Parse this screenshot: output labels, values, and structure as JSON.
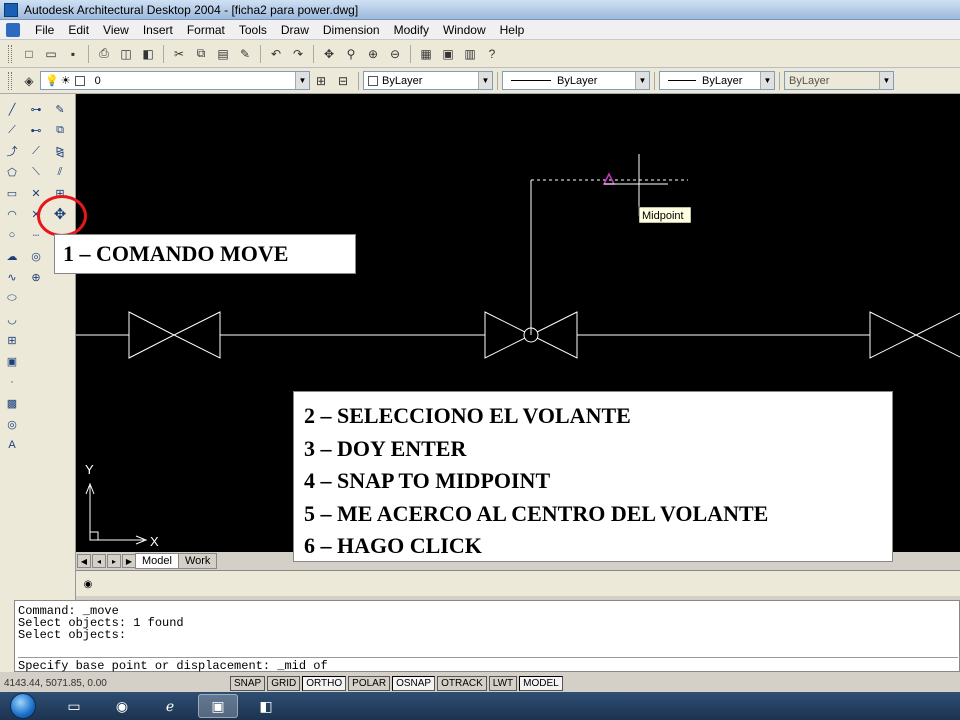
{
  "window": {
    "title": "Autodesk Architectural Desktop 2004 - [ficha2 para power.dwg]"
  },
  "menubar": [
    "File",
    "Edit",
    "View",
    "Insert",
    "Format",
    "Tools",
    "Draw",
    "Dimension",
    "Modify",
    "Window",
    "Help"
  ],
  "toolbar_layers": {
    "layer_value": "0",
    "color_value": "ByLayer",
    "linetype_value": "ByLayer",
    "lineweight_value": "ByLayer",
    "plotstyle_value": "ByLayer"
  },
  "viewport": {
    "tooltip": "Midpoint",
    "ucs_x_label": "X",
    "ucs_y_label": "Y"
  },
  "annotations": {
    "callout1": "1 – COMANDO MOVE",
    "steps": [
      "2 – SELECCIONO EL VOLANTE",
      "3 – DOY ENTER",
      "4 – SNAP TO MIDPOINT",
      "5 – ME ACERCO AL CENTRO DEL VOLANTE",
      "6 – HAGO CLICK"
    ]
  },
  "tabs": [
    "Model",
    "Work"
  ],
  "command_history": [
    "Command: _move",
    "Select objects: 1 found",
    "Select objects:"
  ],
  "command_input": "Specify base point or displacement: _mid of",
  "status": {
    "coords": "4143.44, 5071.85, 0.00",
    "buttons": [
      "SNAP",
      "GRID",
      "ORTHO",
      "POLAR",
      "OSNAP",
      "OTRACK",
      "LWT",
      "MODEL"
    ]
  },
  "colors": {
    "viewport_bg": "#000000",
    "highlight_circle": "#e8161b",
    "snap_marker": "#cc33cc",
    "geometry": "#ffffff"
  },
  "icons": {
    "left_col1": [
      "line-icon",
      "construction-line-icon",
      "polyline-icon",
      "polygon-icon",
      "rectangle-icon",
      "arc-icon",
      "circle-icon",
      "revision-cloud-icon",
      "spline-icon",
      "ellipse-icon",
      "ellipse-arc-icon",
      "insert-block-icon",
      "make-block-icon",
      "point-icon",
      "hatch-icon",
      "region-icon",
      "text-icon"
    ],
    "left_col2": [
      "erase-icon",
      "copy-icon",
      "mirror-icon",
      "offset-icon",
      "array-icon",
      "move-icon",
      "rotate-icon",
      "scale-icon",
      "stretch-icon",
      "trim-icon",
      "extend-icon",
      "break-icon",
      "chamfer-icon",
      "fillet-icon",
      "explode-icon"
    ]
  }
}
